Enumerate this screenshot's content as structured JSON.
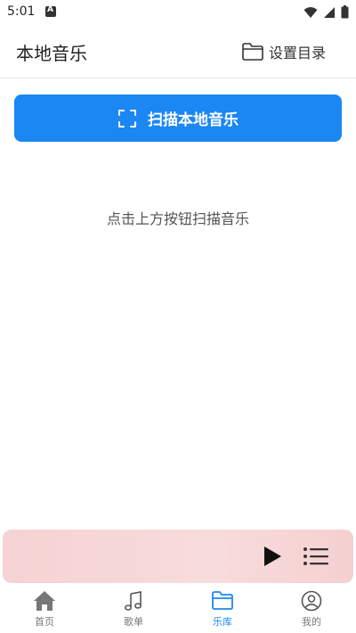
{
  "status_bar": {
    "time": "5:01"
  },
  "header": {
    "title": "本地音乐",
    "set_dir_label": "设置目录"
  },
  "scan": {
    "label": "扫描本地音乐"
  },
  "empty_state": {
    "hint": "点击上方按钮扫描音乐"
  },
  "bottom_nav": {
    "items": [
      {
        "label": "首页",
        "icon": "home-icon"
      },
      {
        "label": "歌单",
        "icon": "music-note-icon"
      },
      {
        "label": "乐库",
        "icon": "folder-icon"
      },
      {
        "label": "我的",
        "icon": "profile-icon"
      }
    ],
    "active_index": 2
  },
  "colors": {
    "accent": "#1b87f3",
    "player_bg": "#f5d2d3"
  }
}
